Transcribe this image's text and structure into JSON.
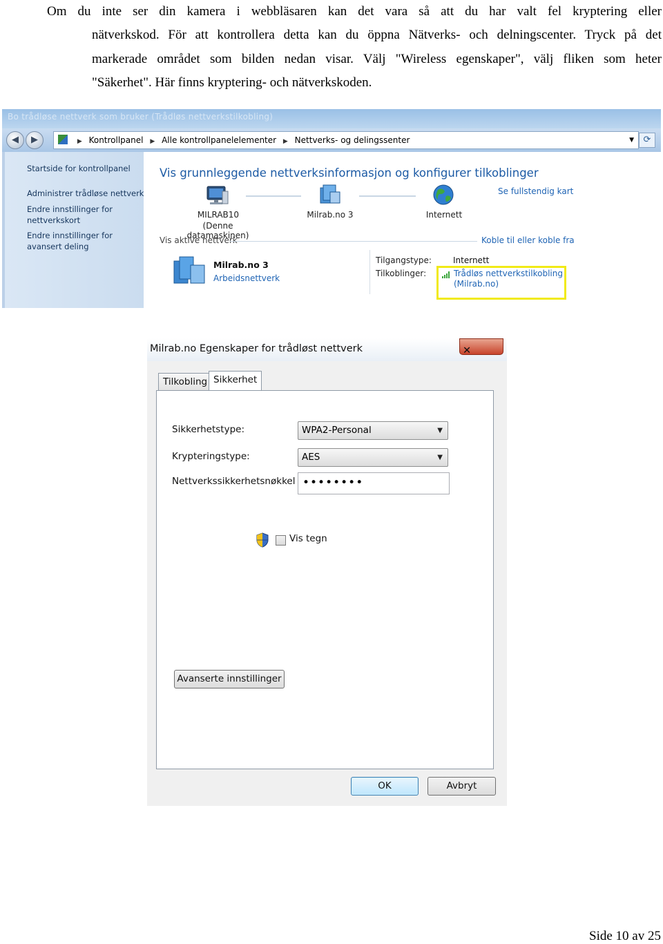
{
  "paragraph": {
    "line1": "Om du inte ser din kamera i webbläsaren kan det vara så att du har valt fel kryptering eller",
    "line2": "nätverkskod. För att kontrollera detta kan du öppna Nätverks- och delningscenter. Tryck på det",
    "line3": "markerade området som bilden nedan visar. Välj \"Wireless egenskaper\", välj fliken som heter",
    "line4": "\"Säkerhet\". Här finns kryptering- och nätverkskoden."
  },
  "network_center": {
    "window_title": "Bo trådløse nettverk som bruker (Trådløs nettverkstilkobling)",
    "breadcrumb": [
      "Kontrollpanel",
      "Alle kontrollpanelelementer",
      "Nettverks- og delingssenter"
    ],
    "sidebar": {
      "home": "Startside for kontrollpanel",
      "items": [
        "Administrer trådløse nettverk",
        "Endre innstillinger for nettverkskort",
        "Endre innstillinger for avansert deling"
      ]
    },
    "heading": "Vis grunnleggende nettverksinformasjon og konfigurer tilkoblinger",
    "full_map_link": "Se fullstendig kart",
    "map_nodes": {
      "computer_name": "MILRAB10",
      "computer_note": "(Denne datamaskinen)",
      "network": "Milrab.no  3",
      "internet": "Internett"
    },
    "active_networks_label": "Vis aktive nettverk",
    "connect_link": "Koble til eller koble fra",
    "active_network": {
      "name": "Milrab.no  3",
      "type": "Arbeidsnettverk",
      "access_type_label": "Tilgangstype:",
      "access_type_value": "Internett",
      "connections_label": "Tilkoblinger:",
      "connection_value_line1": "Trådløs nettverkstilkobling",
      "connection_value_line2": "(Milrab.no)"
    },
    "highlight_color": "#f1ea16"
  },
  "wireless_dialog": {
    "title": "Milrab.no Egenskaper for trådløst nettverk",
    "close_symbol": "✕",
    "tabs": [
      "Tilkobling",
      "Sikkerhet"
    ],
    "active_tab": "Sikkerhet",
    "security_type_label": "Sikkerhetstype:",
    "security_type_value": "WPA2-Personal",
    "encryption_type_label": "Krypteringstype:",
    "encryption_type_value": "AES",
    "key_label": "Nettverkssikkerhetsnøkkel",
    "key_value": "••••••••",
    "show_chars_label": "Vis tegn",
    "advanced_button": "Avanserte innstillinger",
    "ok_button": "OK",
    "cancel_button": "Avbryt"
  },
  "footer": "Side 10 av 25"
}
